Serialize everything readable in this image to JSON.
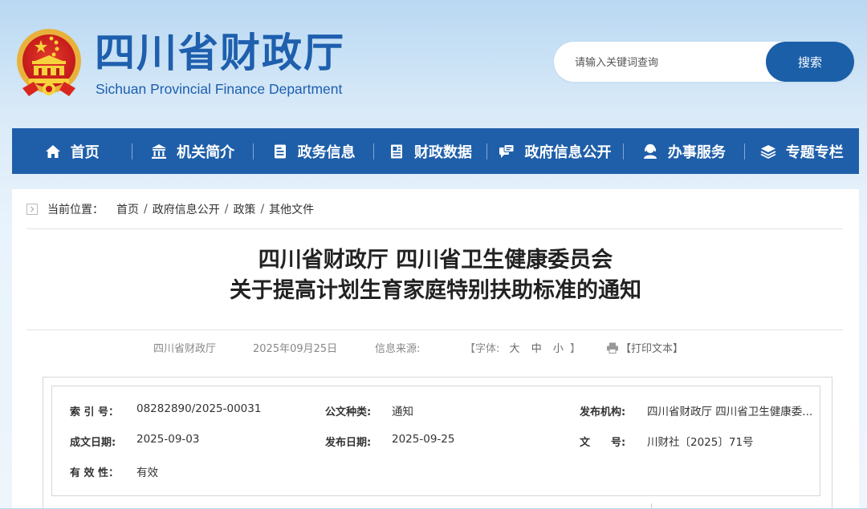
{
  "header": {
    "site_title": "四川省财政厅",
    "site_subtitle": "Sichuan Provincial Finance Department",
    "emblem_icon": "national-emblem-icon",
    "search_placeholder": "请输入关键词查询",
    "search_button": "搜索"
  },
  "nav": {
    "items": [
      {
        "label": "首页",
        "icon": "home-icon"
      },
      {
        "label": "机关简介",
        "icon": "building-icon"
      },
      {
        "label": "政务信息",
        "icon": "document-icon"
      },
      {
        "label": "财政数据",
        "icon": "data-icon"
      },
      {
        "label": "政府信息公开",
        "icon": "chat-icon"
      },
      {
        "label": "办事服务",
        "icon": "user-service-icon"
      },
      {
        "label": "专题专栏",
        "icon": "layers-icon"
      }
    ]
  },
  "breadcrumb": {
    "label": "当前位置：",
    "items": [
      "首页",
      "政府信息公开",
      "政策",
      "其他文件"
    ],
    "separator": "/"
  },
  "article": {
    "title_line1": "四川省财政厅 四川省卫生健康委员会",
    "title_line2": "关于提高计划生育家庭特别扶助标准的通知"
  },
  "meta": {
    "publisher": "四川省财政厅",
    "date": "2025年09月25日",
    "source_label": "信息来源:",
    "font_label": "【字体:",
    "font_large": "大",
    "font_medium": "中",
    "font_small": "小",
    "font_close": "】",
    "print_label": "【打印文本】"
  },
  "info": {
    "index_label": "索 引 号：",
    "index_value": "08282890/2025-00031",
    "category_label": "公文种类:",
    "category_value": "通知",
    "org_label": "发布机构:",
    "org_value": "四川省财政厅 四川省卫生健康委...",
    "written_label": "成文日期:",
    "written_value": "2025-09-03",
    "published_label": "发布日期:",
    "published_value": "2025-09-25",
    "docno_label": "文　　号:",
    "docno_value": "川财社〔2025〕71号",
    "validity_label": "有 效 性：",
    "validity_value": "有效"
  },
  "colors": {
    "brand_blue": "#1f5fa9",
    "title_blue": "#1e5fae"
  }
}
